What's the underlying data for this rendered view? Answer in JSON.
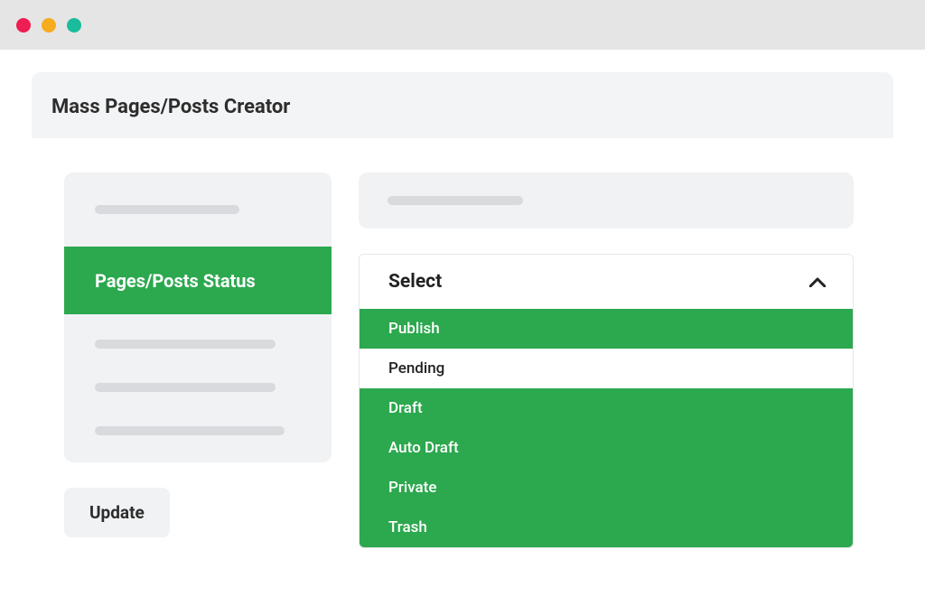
{
  "header": {
    "title": "Mass Pages/Posts Creator"
  },
  "sidebar": {
    "active_label": "Pages/Posts Status"
  },
  "dropdown": {
    "label": "Select",
    "options": [
      {
        "label": "Publish",
        "selected": true
      },
      {
        "label": "Pending",
        "selected": false
      },
      {
        "label": "Draft",
        "selected": true
      },
      {
        "label": "Auto Draft",
        "selected": true
      },
      {
        "label": "Private",
        "selected": true
      },
      {
        "label": "Trash",
        "selected": true
      }
    ]
  },
  "actions": {
    "update_label": "Update"
  }
}
